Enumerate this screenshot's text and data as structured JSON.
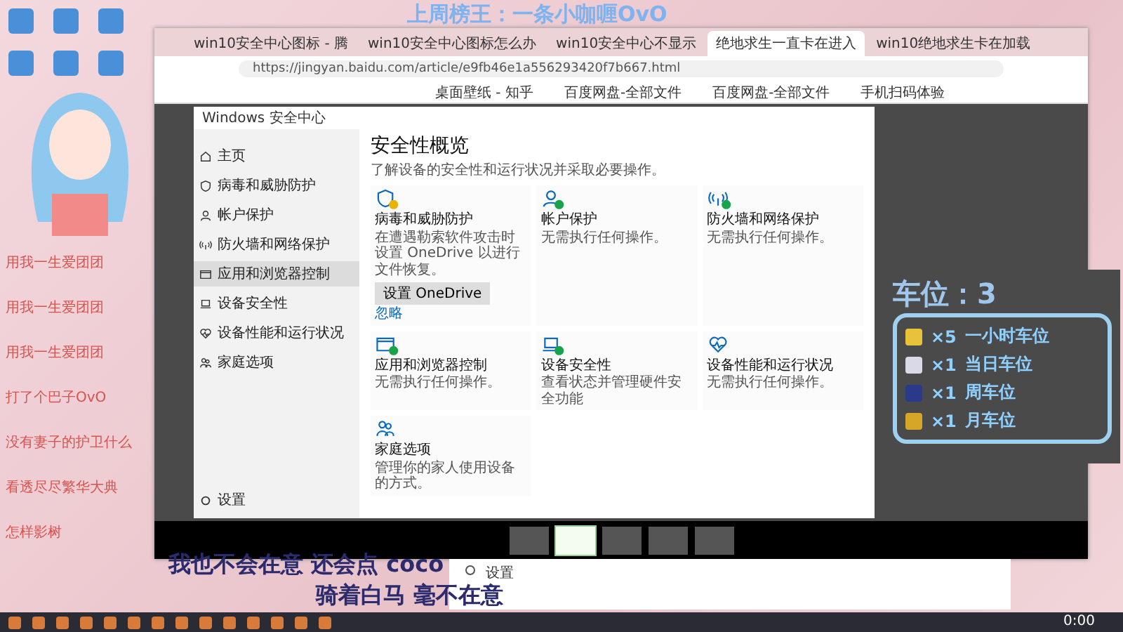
{
  "stream_overlay": {
    "top_banner": "上周榜王：一条小咖喱OvO",
    "car_slots_title": "车位：3",
    "car_slots": [
      {
        "count": "×5",
        "label": "一小时车位",
        "color": "#e8c33a"
      },
      {
        "count": "×1",
        "label": "当日车位",
        "color": "#d9d9e8"
      },
      {
        "count": "×1",
        "label": "周车位",
        "color": "#2a3a8a"
      },
      {
        "count": "×1",
        "label": "月车位",
        "color": "#d6a628"
      }
    ],
    "lyrics": [
      "我也不会在意 还会点 coco",
      "骑着白马 毫不在意"
    ]
  },
  "chat": [
    {
      "text": "用我一生爱团团"
    },
    {
      "text": "用我一生爱团团"
    },
    {
      "text": "用我一生爱团团"
    },
    {
      "text": "打了个巴子OvO"
    },
    {
      "text": "没有妻子的护卫什么"
    },
    {
      "text": "看透尽尽繁华大典"
    },
    {
      "text": "怎样影树"
    }
  ],
  "browser": {
    "tabs": [
      {
        "title": "win10安全中心图标 - 腾",
        "selected": false
      },
      {
        "title": "win10安全中心图标怎么办",
        "selected": false
      },
      {
        "title": "win10安全中心不显示",
        "selected": false
      },
      {
        "title": "绝地求生一直卡在进入",
        "selected": true
      },
      {
        "title": "win10绝地求生卡在加载",
        "selected": false
      }
    ],
    "url": "https://jingyan.baidu.com/article/e9fb46e1a556293420f7b667.html",
    "bookmarks": [
      "桌面壁纸 - 知乎",
      "百度网盘-全部文件",
      "百度网盘-全部文件",
      "手机扫码体验"
    ]
  },
  "security": {
    "title": "Windows 安全中心",
    "nav": [
      {
        "label": "主页",
        "selected": false
      },
      {
        "label": "病毒和威胁防护",
        "selected": false
      },
      {
        "label": "帐户保护",
        "selected": false
      },
      {
        "label": "防火墙和网络保护",
        "selected": false
      },
      {
        "label": "应用和浏览器控制",
        "selected": true
      },
      {
        "label": "设备安全性",
        "selected": false
      },
      {
        "label": "设备性能和运行状况",
        "selected": false
      },
      {
        "label": "家庭选项",
        "selected": false
      }
    ],
    "settings_label": "设置",
    "heading": "安全性概览",
    "subtitle": "了解设备的安全性和运行状况并采取必要操作。",
    "cards": [
      {
        "kind": "warning",
        "title": "病毒和威胁防护",
        "desc": "在遭遇勒索软件攻击时设置 OneDrive 以进行文件恢复。",
        "button": "设置 OneDrive",
        "link": "忽略"
      },
      {
        "kind": "ok",
        "title": "帐户保护",
        "desc": "无需执行任何操作。"
      },
      {
        "kind": "ok",
        "title": "防火墙和网络保护",
        "desc": "无需执行任何操作。"
      },
      {
        "kind": "ok",
        "title": "应用和浏览器控制",
        "desc": "无需执行任何操作。"
      },
      {
        "kind": "ok",
        "title": "设备安全性",
        "desc": "查看状态并管理硬件安全功能"
      },
      {
        "kind": "plain",
        "title": "设备性能和运行状况",
        "desc": "无需执行任何操作。"
      },
      {
        "kind": "plain",
        "title": "家庭选项",
        "desc": "管理你的家人使用设备的方式。"
      }
    ]
  },
  "filmstrip": [
    {
      "selected": false
    },
    {
      "selected": true
    },
    {
      "selected": false
    },
    {
      "selected": false
    },
    {
      "selected": false
    }
  ],
  "behind_window": {
    "settings_label": "设置"
  },
  "taskbar": {
    "clock": "0:00"
  }
}
